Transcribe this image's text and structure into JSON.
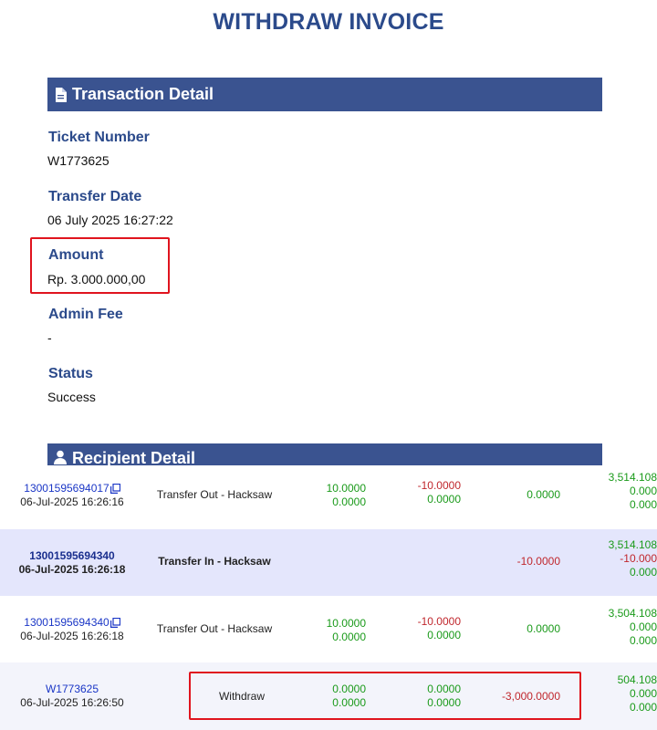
{
  "page": {
    "title": "WITHDRAW INVOICE"
  },
  "transaction_detail": {
    "header": "Transaction Detail",
    "icon": "document-icon",
    "fields": [
      {
        "label": "Ticket Number",
        "value": "W1773625"
      },
      {
        "label": "Transfer Date",
        "value": "06 July 2025 16:27:22"
      },
      {
        "label": "Amount",
        "value": "Rp. 3.000.000,00"
      },
      {
        "label": "Admin Fee",
        "value": "-"
      },
      {
        "label": "Status",
        "value": "Success"
      }
    ]
  },
  "recipient_detail": {
    "header": "Recipient Detail",
    "icon": "user-icon"
  },
  "colors": {
    "header_bg": "#3a5390",
    "label": "#2b4a8b",
    "positive": "#1a9a1a",
    "negative": "#c0272d",
    "link": "#1a36c6",
    "highlight": "#e0141e"
  },
  "transactions": [
    {
      "ref": "13001595694017",
      "time": "06-Jul-2025 16:26:16",
      "desc": "Transfer Out - Hacksaw",
      "col_a": [
        "10.0000",
        "0.0000"
      ],
      "col_b": [
        "-10.0000",
        "0.0000"
      ],
      "col_c": [
        "0.0000"
      ],
      "col_d": [
        "3,514.108",
        "0.000",
        "0.000"
      ]
    },
    {
      "ref": "13001595694340",
      "time": "06-Jul-2025 16:26:18",
      "desc": "Transfer In - Hacksaw",
      "col_a": [],
      "col_b": [],
      "col_c": [
        "-10.0000"
      ],
      "col_d": [
        "3,514.108",
        "-10.000",
        "0.000"
      ]
    },
    {
      "ref": "13001595694340",
      "time": "06-Jul-2025 16:26:18",
      "desc": "Transfer Out - Hacksaw",
      "col_a": [
        "10.0000",
        "0.0000"
      ],
      "col_b": [
        "-10.0000",
        "0.0000"
      ],
      "col_c": [
        "0.0000"
      ],
      "col_d": [
        "3,504.108",
        "0.000",
        "0.000"
      ]
    },
    {
      "ref": "W1773625",
      "time": "06-Jul-2025 16:26:50",
      "desc": "Withdraw",
      "col_a": [
        "0.0000",
        "0.0000"
      ],
      "col_b": [
        "0.0000",
        "0.0000"
      ],
      "col_c": [
        "-3,000.0000"
      ],
      "col_d": [
        "504.108",
        "0.000",
        "0.000"
      ]
    }
  ]
}
